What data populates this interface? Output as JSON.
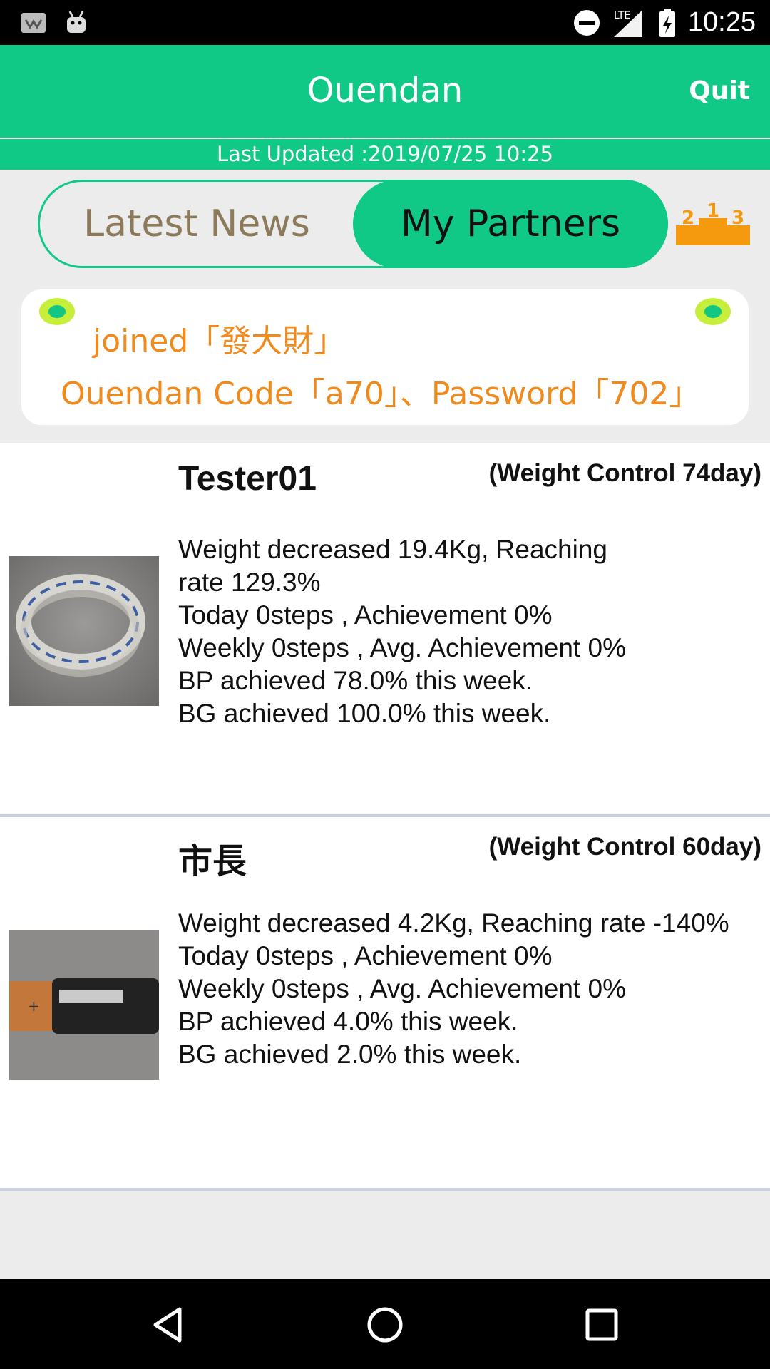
{
  "status_bar": {
    "time": "10:25",
    "network": "LTE"
  },
  "app_bar": {
    "title": "Ouendan",
    "quit_label": "Quit"
  },
  "last_updated": "Last Updated :2019/07/25 10:25",
  "tabs": [
    {
      "label": "Latest News",
      "selected": false
    },
    {
      "label": "My Partners",
      "selected": true
    }
  ],
  "ranking_icon": {
    "name": "ranking-podium-icon",
    "numbers": [
      "2",
      "1",
      "3"
    ]
  },
  "notice": {
    "line1": "joined「發大財」",
    "line2": "Ouendan Code「a70」、Password「702」"
  },
  "partners": [
    {
      "name": "Tester01",
      "plan": "(Weight Control 74day)",
      "photo": "tape-roll-photo",
      "stats": [
        "Weight decreased 19.4Kg, Reaching",
        "rate 129.3%",
        "Today 0steps , Achievement 0%",
        "Weekly 0steps , Avg. Achievement 0%",
        "BP achieved 78.0% this week.",
        "BG achieved 100.0% this week."
      ]
    },
    {
      "name": "市長",
      "plan": "(Weight Control 60day)",
      "photo": "battery-photo",
      "stats": [
        "Weight decreased 4.2Kg, Reaching rate -140%",
        "Today 0steps , Achievement 0%",
        "Weekly 0steps , Avg. Achievement 0%",
        "BP achieved 4.0% this week.",
        "BG achieved 2.0% this week."
      ]
    }
  ],
  "colors": {
    "accent": "#10c986",
    "notice_text": "#f08a1c",
    "podium": "#f59a0e"
  }
}
